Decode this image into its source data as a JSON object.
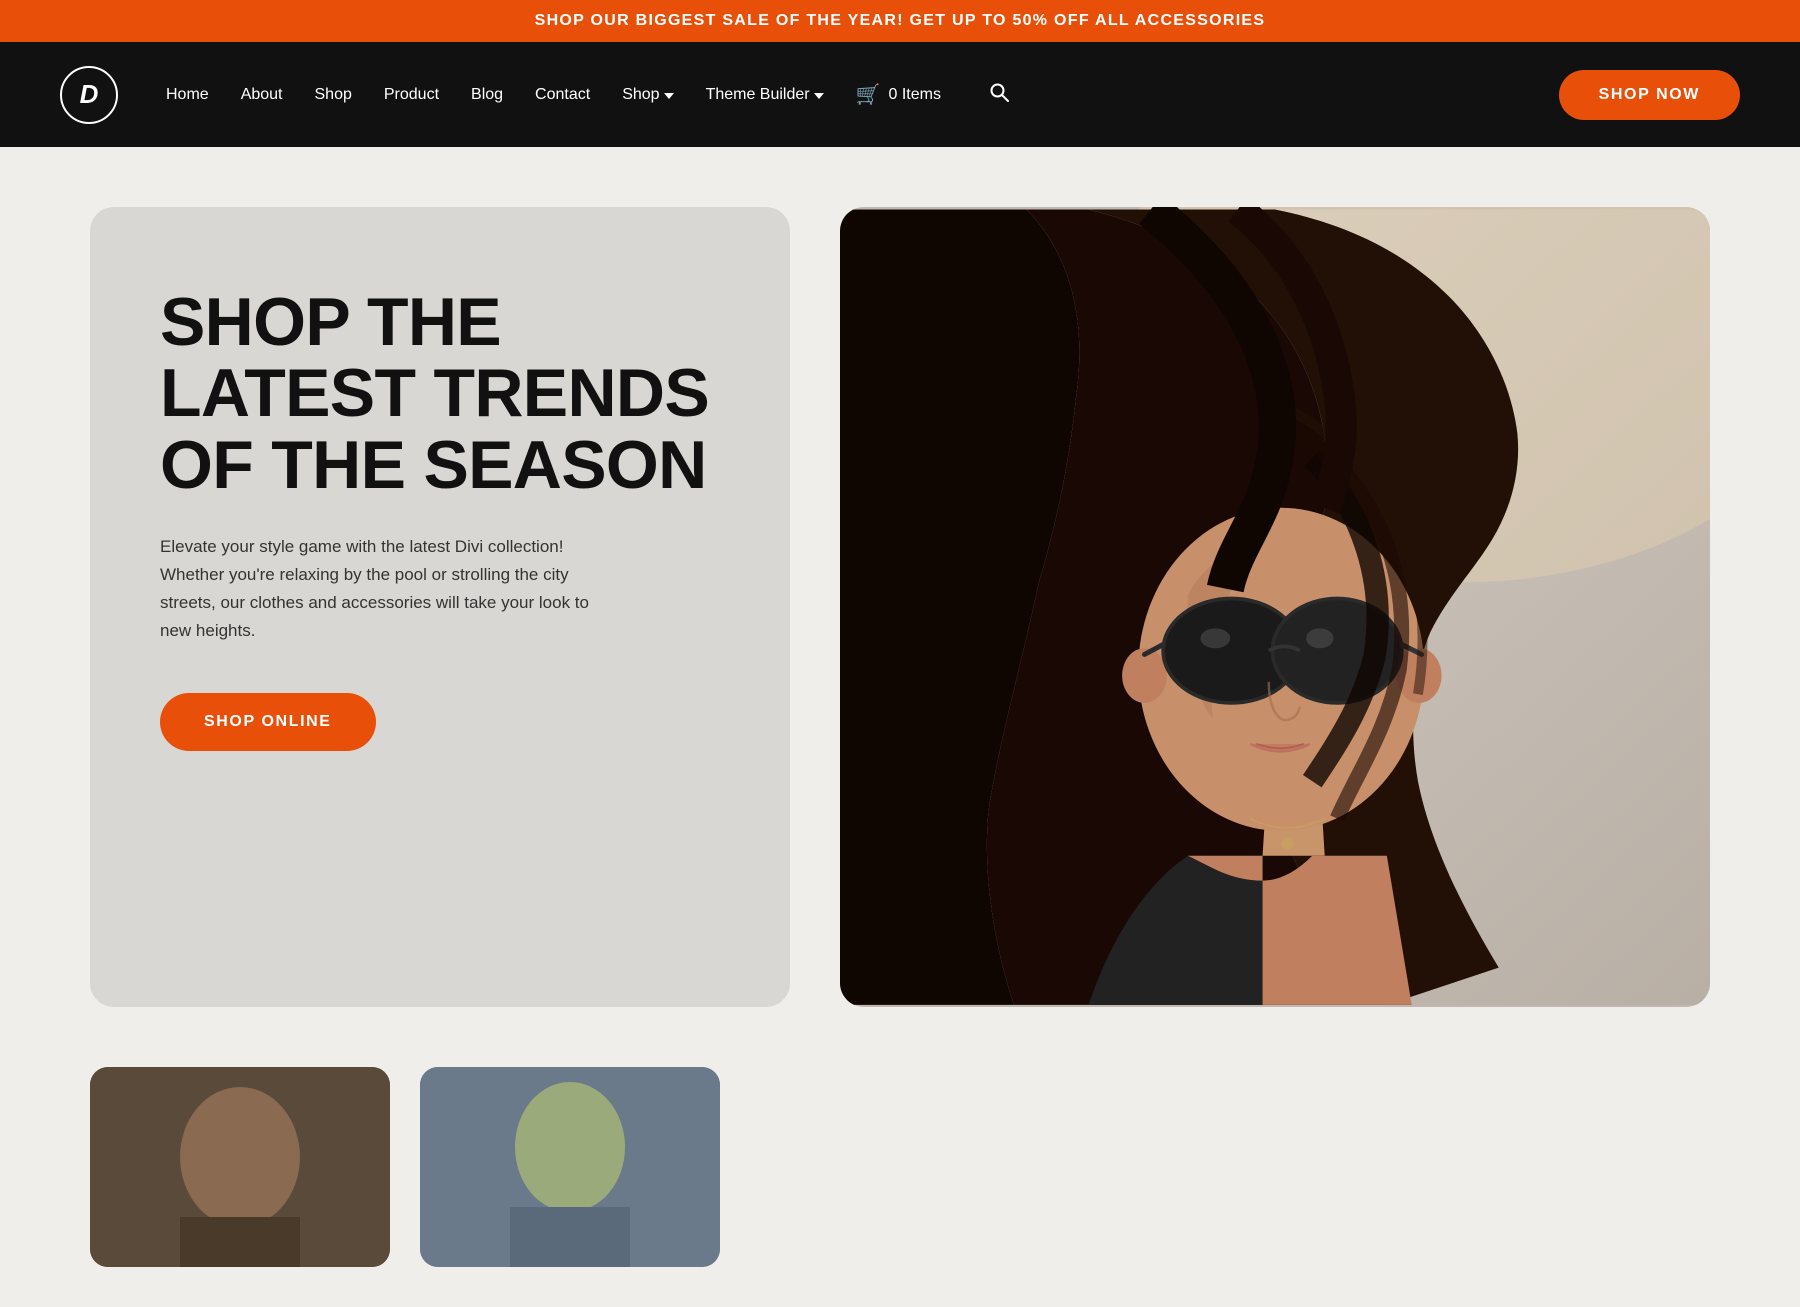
{
  "announcement": {
    "text": "SHOP OUR BIGGEST SALE OF THE YEAR! GET UP TO 50% OFF ALL ACCESSORIES"
  },
  "navbar": {
    "logo_letter": "D",
    "nav_items": [
      {
        "label": "Home",
        "has_dropdown": false
      },
      {
        "label": "About",
        "has_dropdown": false
      },
      {
        "label": "Shop",
        "has_dropdown": false
      },
      {
        "label": "Product",
        "has_dropdown": false
      },
      {
        "label": "Blog",
        "has_dropdown": false
      },
      {
        "label": "Contact",
        "has_dropdown": false
      },
      {
        "label": "Shop",
        "has_dropdown": true
      },
      {
        "label": "Theme Builder",
        "has_dropdown": true
      }
    ],
    "cart_label": "0 Items",
    "shop_now_label": "SHOP NOW"
  },
  "hero": {
    "title": "SHOP THE LATEST TRENDS OF THE SEASON",
    "description": "Elevate your style game with the latest Divi collection! Whether you're relaxing by the pool or strolling the city streets, our clothes and accessories will take your look to new heights.",
    "cta_label": "SHOP ONLINE"
  }
}
